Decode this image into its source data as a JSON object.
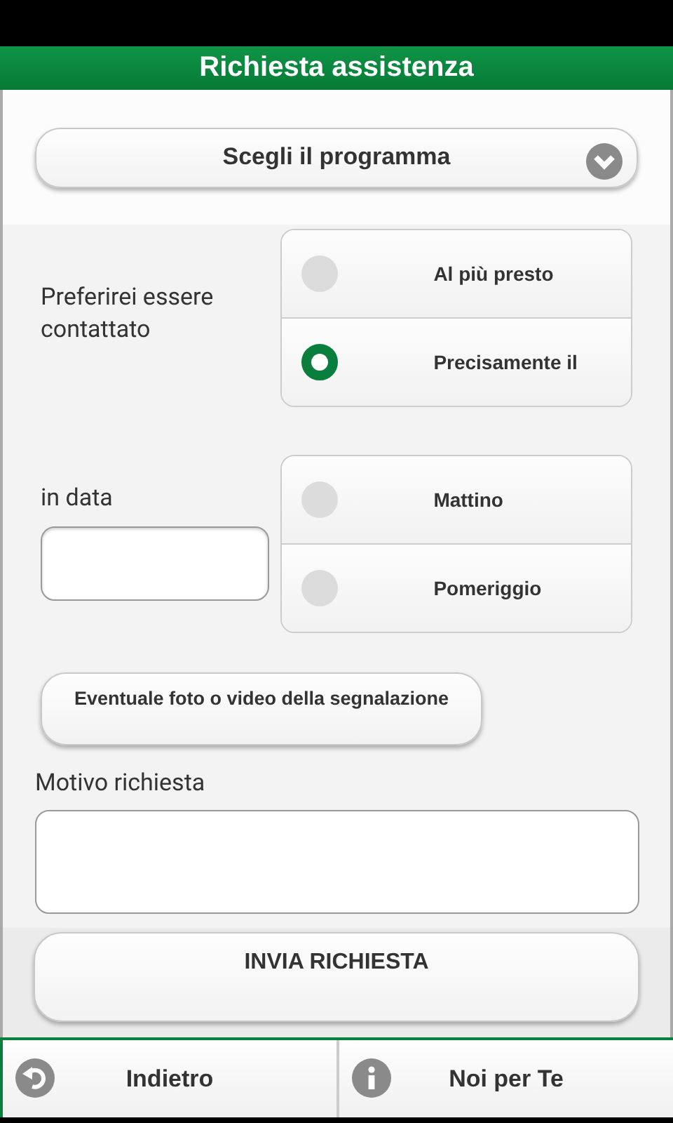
{
  "header": {
    "title": "Richiesta assistenza"
  },
  "program_select": {
    "label": "Scegli il programma"
  },
  "contact": {
    "label": "Preferirei essere contattato",
    "options": [
      {
        "label": "Al più presto",
        "selected": false
      },
      {
        "label": "Precisamente il",
        "selected": true
      }
    ]
  },
  "date": {
    "label": "in data",
    "options": [
      {
        "label": "Mattino",
        "selected": false
      },
      {
        "label": "Pomeriggio",
        "selected": false
      }
    ]
  },
  "attachment_button": "Eventuale foto o video della segnalazione",
  "reason": {
    "label": "Motivo richiesta"
  },
  "submit_button": "INVIA RICHIESTA",
  "nav": [
    {
      "label": "Indietro",
      "kind": "back"
    },
    {
      "label": "Noi per Te",
      "kind": "info"
    }
  ]
}
